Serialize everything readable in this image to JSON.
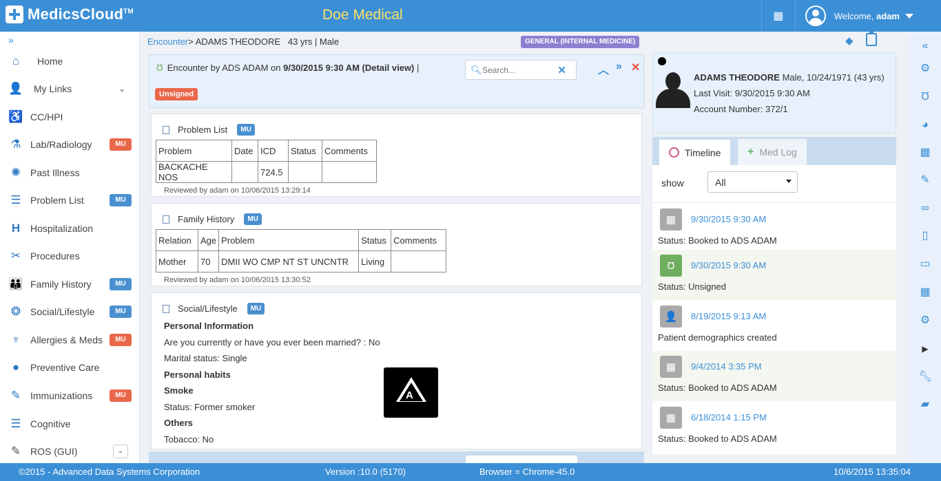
{
  "topbar": {
    "brand_name": "MedicsCloud",
    "brand_tm": "TM",
    "practice": "Doe Medical",
    "welcome_prefix": "Welcome,",
    "username": "adam"
  },
  "sidebar": {
    "toggle": "»",
    "items": [
      {
        "label": "Home",
        "icon": "home-icon",
        "badge": ""
      },
      {
        "label": "My Links",
        "icon": "user-icon",
        "badge": ""
      },
      {
        "label": "CC/HPI",
        "icon": "wheelchair-icon",
        "badge": ""
      },
      {
        "label": "Lab/Radiology",
        "icon": "lab-icon",
        "badge": "MU"
      },
      {
        "label": "Past Illness",
        "icon": "virus-icon",
        "badge": ""
      },
      {
        "label": "Problem List",
        "icon": "list-icon",
        "badge": "MU"
      },
      {
        "label": "Hospitalization",
        "icon": "hospital-icon",
        "badge": ""
      },
      {
        "label": "Procedures",
        "icon": "scissors-icon",
        "badge": ""
      },
      {
        "label": "Family History",
        "icon": "family-icon",
        "badge": "MU"
      },
      {
        "label": "Social/Lifestyle",
        "icon": "social-icon",
        "badge": "MU"
      },
      {
        "label": "Allergies & Meds",
        "icon": "allergy-icon",
        "badge": "MU"
      },
      {
        "label": "Preventive Care",
        "icon": "apple-icon",
        "badge": ""
      },
      {
        "label": "Immunizations",
        "icon": "syringe-icon",
        "badge": "MU"
      },
      {
        "label": "Cognitive",
        "icon": "list-icon",
        "badge": ""
      },
      {
        "label": "ROS (GUI)",
        "icon": "edit-icon",
        "badge": ""
      }
    ]
  },
  "breadcrumb": {
    "section": "Encounter",
    "separator": ">",
    "patient": "ADAMS THEODORE",
    "age_sex": "43 yrs | Male",
    "specialty": "GENERAL (INTERNAL MEDICINE)"
  },
  "encounter": {
    "prefix": "Encounter by ADS ADAM on",
    "datetime": "9/30/2015 9:30 AM (Detail view)",
    "suffix": "|",
    "search_placeholder": "Search...",
    "status": "Unsigned"
  },
  "problem_list": {
    "title": "Problem List",
    "badge": "MU",
    "headers": [
      "Problem",
      "Date",
      "ICD",
      "Status",
      "Comments"
    ],
    "rows": [
      [
        "BACKACHE NOS",
        "",
        "724.5",
        "",
        ""
      ]
    ],
    "reviewed": "Reviewed by adam on 10/06/2015 13:29:14"
  },
  "family_history": {
    "title": "Family History",
    "badge": "MU",
    "headers": [
      "Relation",
      "Age",
      "Problem",
      "Status",
      "Comments"
    ],
    "rows": [
      [
        "Mother",
        "70",
        "DMII WO CMP NT ST UNCNTR",
        "Living",
        ""
      ]
    ],
    "reviewed": "Reviewed by adam on 10/06/2015 13:30:52"
  },
  "social": {
    "title": "Social/Lifestyle",
    "badge": "MU",
    "lines": [
      {
        "text": "Personal Information",
        "bold": true
      },
      {
        "text": "Are you currently or have you ever been married? : No",
        "bold": false
      },
      {
        "text": "Marital status: Single",
        "bold": false
      },
      {
        "text": "Personal habits",
        "bold": true
      },
      {
        "text": "Smoke",
        "bold": true
      },
      {
        "text": "Status: Former smoker",
        "bold": false
      },
      {
        "text": "Others",
        "bold": true
      },
      {
        "text": "Tobacco: No",
        "bold": false
      }
    ]
  },
  "patient": {
    "name": "ADAMS THEODORE",
    "details": "Male, 10/24/1971 (43 yrs)",
    "last_visit": "Last Visit: 9/30/2015 9:30 AM",
    "account": "Account Number: 372/1"
  },
  "timeline": {
    "tab_active": "Timeline",
    "tab_inactive": "Med Log",
    "show_label": "show",
    "show_value": "All",
    "items": [
      {
        "date": "9/30/2015 9:30 AM",
        "status": "Status: Booked to ADS ADAM",
        "icon": "calendar-icon"
      },
      {
        "date": "9/30/2015 9:30 AM",
        "status": "Status: Unsigned",
        "icon": "stethoscope-icon"
      },
      {
        "date": "8/19/2015 9:13 AM",
        "status": "Patient demographics created",
        "icon": "person-icon"
      },
      {
        "date": "9/4/2014 3:35 PM",
        "status": "Status: Booked to ADS ADAM",
        "icon": "calendar-icon"
      },
      {
        "date": "6/18/2014 1:15 PM",
        "status": "Status: Booked to ADS ADAM",
        "icon": "calendar-icon"
      }
    ]
  },
  "footer": {
    "copyright": "©2015 - Advanced Data Systems Corporation",
    "version": "Version :10.0 (5170)",
    "browser": "Browser = Chrome-45.0",
    "datetime": "10/6/2015 13:35:04"
  },
  "colors": {
    "primary": "#3b8fd6",
    "practice_name": "#ffe066",
    "mu_blue": "#4a90d0",
    "mu_red": "#e9674a",
    "specialty_badge": "#8f7fd0"
  }
}
